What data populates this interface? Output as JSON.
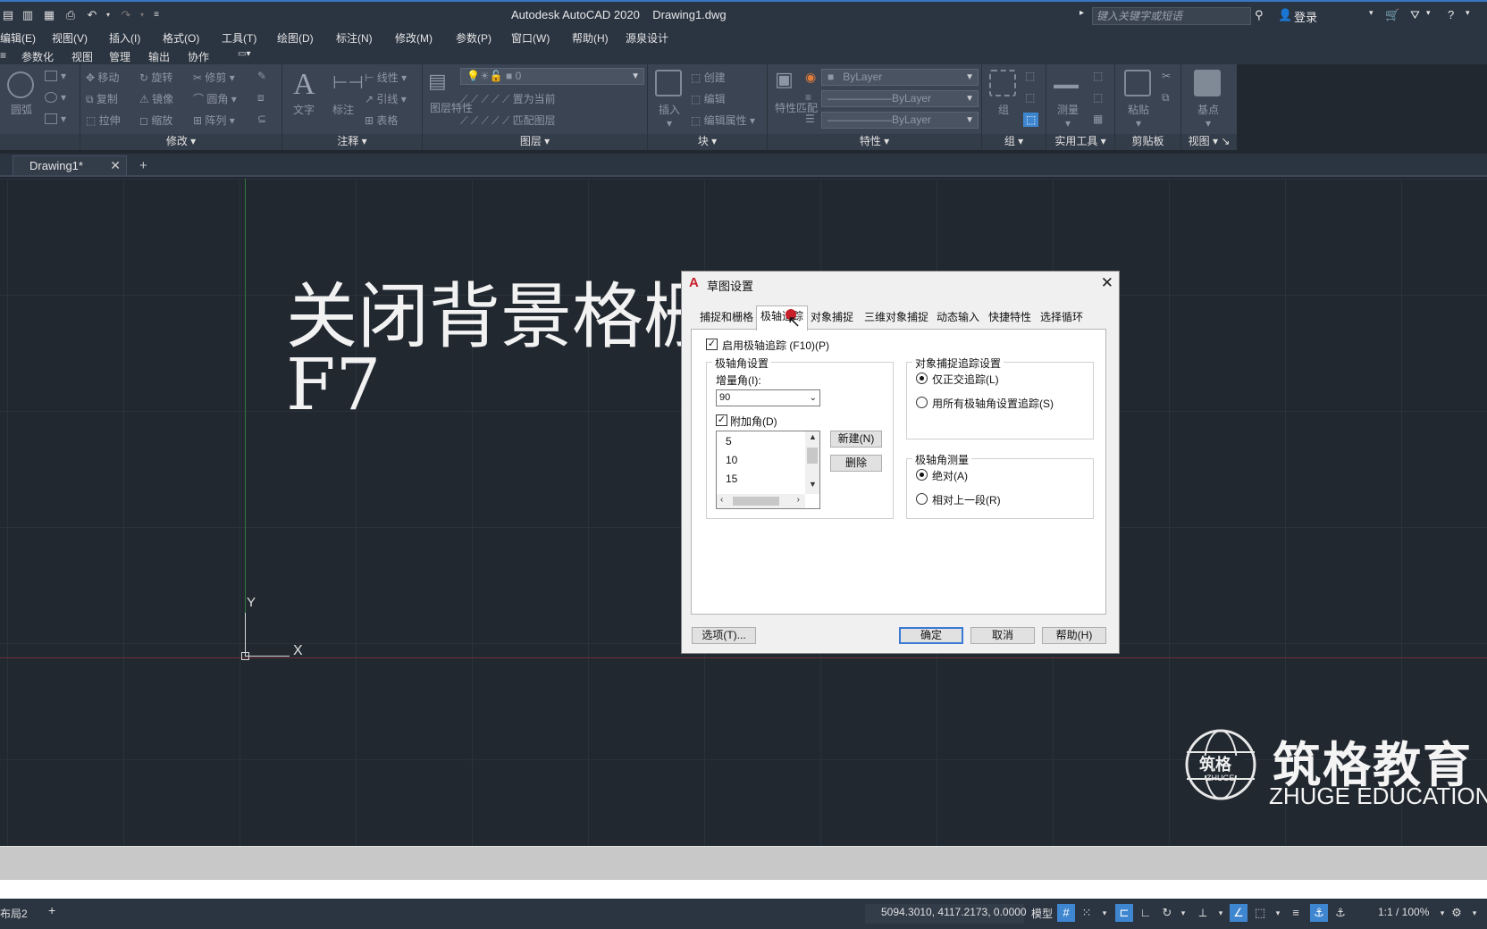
{
  "window": {
    "title": "Autodesk AutoCAD 2020    Drawing1.dwg"
  },
  "titlebar": {
    "search_placeholder": "键入关键字或短语",
    "login": "登录"
  },
  "menubar": [
    "编辑(E)",
    "视图(V)",
    "插入(I)",
    "格式(O)",
    "工具(T)",
    "绘图(D)",
    "标注(N)",
    "修改(M)",
    "参数(P)",
    "窗口(W)",
    "帮助(H)",
    "源泉设计"
  ],
  "ribbon_tabs": [
    "参数化",
    "视图",
    "管理",
    "输出",
    "协作"
  ],
  "ribbon": {
    "draw": {
      "circle": "圆弧"
    },
    "modify": {
      "title": "修改",
      "move": "移动",
      "rotate": "旋转",
      "trim": "修剪",
      "copy": "复制",
      "mirror": "镜像",
      "fillet": "圆角",
      "stretch": "拉伸",
      "scale": "缩放",
      "array": "阵列"
    },
    "annotation": {
      "title": "注释",
      "text": "文字",
      "dim": "标注",
      "linear": "线性",
      "leader": "引线",
      "table": "表格"
    },
    "layers": {
      "title": "图层",
      "props": "图层特性",
      "current_layer": "0",
      "set_current": "置为当前",
      "match": "匹配图层"
    },
    "block": {
      "title": "块",
      "insert": "插入",
      "create": "创建",
      "edit": "编辑",
      "edit_attr": "编辑属性"
    },
    "properties": {
      "title": "特性",
      "match": "特性匹配",
      "color": "ByLayer",
      "linetype": "ByLayer",
      "lineweight": "ByLayer"
    },
    "groups": {
      "title": "组",
      "group": "组"
    },
    "utilities": {
      "title": "实用工具",
      "measure": "测量"
    },
    "clipboard": {
      "title": "剪贴板",
      "paste": "粘贴"
    },
    "view": {
      "title": "视图",
      "base": "基点"
    }
  },
  "doc_tab": {
    "label": "Drawing1*"
  },
  "canvas": {
    "line1": "关闭背景格栅",
    "line2": "F7",
    "axis_y": "Y",
    "axis_x": "X"
  },
  "dialog": {
    "title": "草图设置",
    "tabs": [
      "捕捉和栅格",
      "极轴追踪",
      "对象捕捉",
      "三维对象捕捉",
      "动态输入",
      "快捷特性",
      "选择循环"
    ],
    "active_tab": 1,
    "enable_polar": "启用极轴追踪 (F10)(P)",
    "polar_angle_group": "极轴角设置",
    "increment_label": "增量角(I):",
    "increment_value": "90",
    "additional_label": "附加角(D)",
    "additional_list": [
      "5",
      "10",
      "15"
    ],
    "new_btn": "新建(N)",
    "delete_btn": "删除",
    "osnap_group": "对象捕捉追踪设置",
    "ortho_only": "仅正交追踪(L)",
    "all_polar": "用所有极轴角设置追踪(S)",
    "measure_group": "极轴角测量",
    "absolute": "绝对(A)",
    "relative": "相对上一段(R)",
    "options_btn": "选项(T)...",
    "ok_btn": "确定",
    "cancel_btn": "取消",
    "help_btn": "帮助(H)"
  },
  "watermark": {
    "brand_cn": "筑格教育",
    "brand_en": "ZHUGE EDUCATION",
    "logo_cn": "筑格",
    "logo_en": "ZHUGE"
  },
  "statusbar": {
    "layout": "布局2",
    "coords": "5094.3010, 4117.2173, 0.0000",
    "model": "模型",
    "scale": "1:1 / 100%"
  }
}
